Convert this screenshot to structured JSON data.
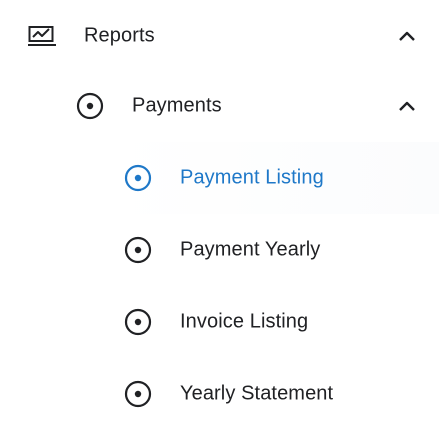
{
  "menu": {
    "reports": {
      "label": "Reports",
      "icon": "report-chart-icon",
      "expanded": true
    },
    "payments": {
      "label": "Payments",
      "icon": "radio-dot-icon",
      "expanded": true
    },
    "items": [
      {
        "label": "Payment Listing",
        "icon": "radio-dot-icon",
        "active": true
      },
      {
        "label": "Payment Yearly",
        "icon": "radio-dot-icon",
        "active": false
      },
      {
        "label": "Invoice Listing",
        "icon": "radio-dot-icon",
        "active": false
      },
      {
        "label": "Yearly Statement",
        "icon": "radio-dot-icon",
        "active": false
      }
    ]
  },
  "colors": {
    "text": "#202124",
    "active": "#1e78c8",
    "icon": "#202124",
    "background": "#ffffff"
  }
}
